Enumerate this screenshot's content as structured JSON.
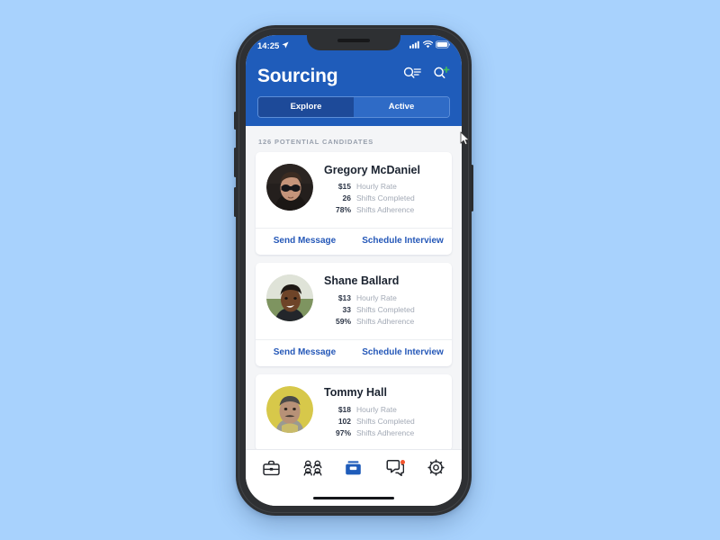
{
  "device": {
    "status_bar": {
      "time": "14:25",
      "location_icon": "location-arrow-icon",
      "signal_icon": "cellular-signal-icon",
      "wifi_icon": "wifi-icon",
      "battery_icon": "battery-full-icon"
    },
    "home_indicator": "home-indicator"
  },
  "theme": {
    "page_background": "#a8d2fd",
    "header_blue": "#1f5cba",
    "tab_selected_blue": "#1d4a99",
    "tab_unselected_blue": "#2f6bc6",
    "link_blue": "#2558b8",
    "accent_green": "#3fbf5a",
    "badge_red": "#f2542d",
    "content_background": "#f4f5f7",
    "card_background": "#ffffff",
    "muted_text": "#a3aab6",
    "section_label_text": "#98a0ad"
  },
  "header": {
    "title": "Sourcing",
    "actions": [
      {
        "name": "search-list-icon",
        "label": "Search list"
      },
      {
        "name": "search-add-icon",
        "label": "Add search"
      }
    ],
    "tabs": [
      {
        "label": "Explore",
        "selected": true
      },
      {
        "label": "Active",
        "selected": false
      }
    ]
  },
  "main": {
    "section_label": "126 POTENTIAL CANDIDATES",
    "candidate_count": 126,
    "stat_labels": {
      "hourly_rate": "Hourly Rate",
      "shifts_completed": "Shifts Completed",
      "shifts_adherence": "Shifts Adherence"
    },
    "actions": {
      "send_message": "Send Message",
      "schedule_interview": "Schedule Interview"
    },
    "candidates": [
      {
        "name": "Gregory McDaniel",
        "hourly_rate": "$15",
        "shifts_completed": "26",
        "shifts_adherence": "78%",
        "avatar": "avatar-gregory-mcdaniel",
        "show_actions": true
      },
      {
        "name": "Shane Ballard",
        "hourly_rate": "$13",
        "shifts_completed": "33",
        "shifts_adherence": "59%",
        "avatar": "avatar-shane-ballard",
        "show_actions": true
      },
      {
        "name": "Tommy Hall",
        "hourly_rate": "$18",
        "shifts_completed": "102",
        "shifts_adherence": "97%",
        "avatar": "avatar-tommy-hall",
        "show_actions": false
      }
    ]
  },
  "tab_bar": {
    "items": [
      {
        "name": "briefcase-icon",
        "label": "Jobs",
        "active": false,
        "badge": false
      },
      {
        "name": "people-icon",
        "label": "People",
        "active": false,
        "badge": false
      },
      {
        "name": "inbox-icon",
        "label": "Sourcing",
        "active": true,
        "badge": false
      },
      {
        "name": "chat-icon",
        "label": "Messages",
        "active": false,
        "badge": true
      },
      {
        "name": "gear-icon",
        "label": "Settings",
        "active": false,
        "badge": false
      }
    ]
  }
}
